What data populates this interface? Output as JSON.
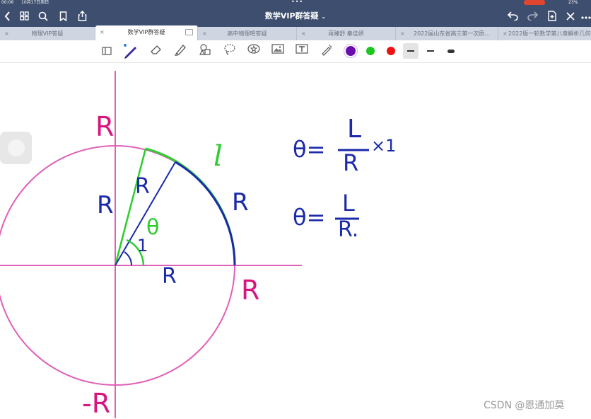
{
  "status": {
    "time": "00:06",
    "date": "10月17日周日",
    "battery": "23%"
  },
  "titlebar": {
    "title": "数学VIP群答疑",
    "back_icon": "chevron-left-icon",
    "grid_icon": "grid-icon",
    "search_icon": "search-icon",
    "bookmark_icon": "bookmark-icon",
    "share_icon": "share-icon",
    "undo_icon": "undo-icon",
    "redo_icon": "redo-icon",
    "add_page_icon": "add-page-icon",
    "close_icon": "close-icon",
    "more_icon": "more-icon"
  },
  "tabs": [
    {
      "label": "物理VIP答疑"
    },
    {
      "label": "数学VIP群答疑"
    },
    {
      "label": "高中物理吧答疑"
    },
    {
      "label": "蒋臻舒 秦佳妍"
    },
    {
      "label": "2022届山东省高三第一次质..."
    },
    {
      "label": "2022版一轮数学第八章解析几何"
    }
  ],
  "toolbar": {
    "colors": [
      "#6a0dad",
      "#1ec51e",
      "#ee1111"
    ],
    "tools": [
      "read-mode-icon",
      "pen-icon",
      "eraser-icon",
      "highlighter-icon",
      "shapes-icon",
      "lasso-icon",
      "sticker-icon",
      "image-icon",
      "text-icon",
      "laser-pointer-icon"
    ]
  },
  "canvas": {
    "labels": {
      "r_top": "R",
      "r_left": "R",
      "r_radius": "R",
      "r_bottom_radius": "R",
      "r_arc": "R",
      "r_right": "R",
      "r_neg": "-R",
      "theta": "θ",
      "one": "1",
      "arc_l": "l",
      "formula1_theta": "θ=",
      "formula1_num": "L",
      "formula1_den": "R",
      "formula1_suffix": "×1",
      "formula2_theta": "θ=",
      "formula2_num": "L",
      "formula2_den": "R."
    },
    "colors": {
      "magenta": "#e060b8",
      "navy": "#1a2aa8",
      "green": "#2ecc2e",
      "label_pink": "#d6157f"
    }
  },
  "watermark": "CSDN @恩通加莫"
}
